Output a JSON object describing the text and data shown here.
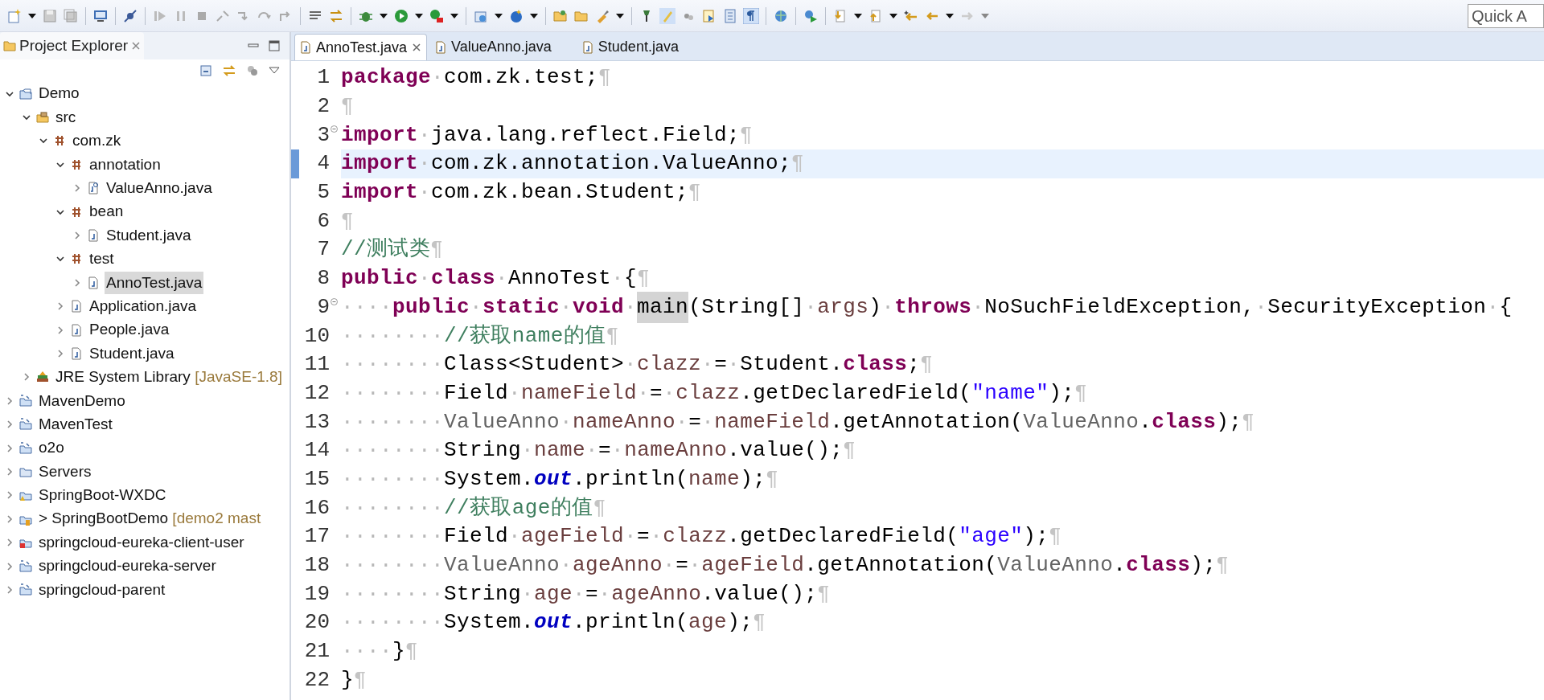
{
  "toolbar": {
    "quick_access": {
      "placeholder": "Quick A"
    }
  },
  "explorer": {
    "title": "Project Explorer",
    "tree": [
      {
        "label": "Demo",
        "kind": "project",
        "expanded": true,
        "selected": false,
        "children": [
          {
            "label": "src",
            "kind": "source-folder",
            "expanded": true,
            "selected": false,
            "children": [
              {
                "label": "com.zk",
                "kind": "package",
                "expanded": true,
                "selected": false,
                "children": [
                  {
                    "label": "annotation",
                    "kind": "package",
                    "expanded": true,
                    "selected": false,
                    "children": [
                      {
                        "label": "ValueAnno.java",
                        "kind": "annotation-file",
                        "expanded": false,
                        "selected": false
                      }
                    ]
                  },
                  {
                    "label": "bean",
                    "kind": "package",
                    "expanded": true,
                    "selected": false,
                    "children": [
                      {
                        "label": "Student.java",
                        "kind": "java-file",
                        "expanded": false,
                        "selected": false
                      }
                    ]
                  },
                  {
                    "label": "test",
                    "kind": "package",
                    "expanded": true,
                    "selected": false,
                    "children": [
                      {
                        "label": "AnnoTest.java",
                        "kind": "java-file",
                        "expanded": false,
                        "selected": true
                      }
                    ]
                  },
                  {
                    "label": "Application.java",
                    "kind": "java-file",
                    "expanded": false,
                    "selected": false
                  },
                  {
                    "label": "People.java",
                    "kind": "java-file",
                    "expanded": false,
                    "selected": false
                  },
                  {
                    "label": "Student.java",
                    "kind": "java-file",
                    "expanded": false,
                    "selected": false
                  }
                ]
              }
            ]
          },
          {
            "label": "JRE System Library",
            "decoration": "[JavaSE-1.8]",
            "kind": "library",
            "expanded": false,
            "selected": false
          }
        ]
      },
      {
        "label": "MavenDemo",
        "kind": "maven-project",
        "expanded": false,
        "selected": false
      },
      {
        "label": "MavenTest",
        "kind": "maven-project",
        "expanded": false,
        "selected": false
      },
      {
        "label": "o2o",
        "kind": "maven-project",
        "expanded": false,
        "selected": false
      },
      {
        "label": "Servers",
        "kind": "folder",
        "expanded": false,
        "selected": false
      },
      {
        "label": "SpringBoot-WXDC",
        "kind": "warning-project",
        "expanded": false,
        "selected": false
      },
      {
        "label": "> SpringBootDemo",
        "decoration": "[demo2 mast",
        "kind": "git-project",
        "expanded": false,
        "selected": false
      },
      {
        "label": "springcloud-eureka-client-user",
        "kind": "error-project",
        "expanded": false,
        "selected": false
      },
      {
        "label": "springcloud-eureka-server",
        "kind": "maven-project",
        "expanded": false,
        "selected": false
      },
      {
        "label": "springcloud-parent",
        "kind": "maven-project",
        "expanded": false,
        "selected": false
      }
    ]
  },
  "editor": {
    "tabs": [
      {
        "label": "AnnoTest.java",
        "selected": true
      },
      {
        "label": "ValueAnno.java",
        "selected": false
      },
      {
        "label": "Student.java",
        "selected": false
      }
    ],
    "lines": [
      {
        "no": "1",
        "fold": false,
        "current": false,
        "tokens": [
          {
            "kind": "kw",
            "text": "package"
          },
          {
            "kind": "ws",
            "text": "·"
          },
          {
            "kind": "p",
            "text": "com.zk.test;"
          },
          {
            "kind": "eol",
            "text": "¶"
          }
        ]
      },
      {
        "no": "2",
        "fold": false,
        "current": false,
        "tokens": [
          {
            "kind": "eol",
            "text": "¶"
          }
        ]
      },
      {
        "no": "3",
        "fold": true,
        "current": false,
        "tokens": [
          {
            "kind": "kw",
            "text": "import"
          },
          {
            "kind": "ws",
            "text": "·"
          },
          {
            "kind": "p",
            "text": "java.lang.reflect.Field;"
          },
          {
            "kind": "eol",
            "text": "¶"
          }
        ]
      },
      {
        "no": "4",
        "fold": false,
        "current": true,
        "tokens": [
          {
            "kind": "kw",
            "text": "import"
          },
          {
            "kind": "ws",
            "text": "·"
          },
          {
            "kind": "p",
            "text": "com.zk.annotation.ValueAnno;"
          },
          {
            "kind": "eol",
            "text": "¶"
          }
        ]
      },
      {
        "no": "5",
        "fold": false,
        "current": false,
        "tokens": [
          {
            "kind": "kw",
            "text": "import"
          },
          {
            "kind": "ws",
            "text": "·"
          },
          {
            "kind": "p",
            "text": "com.zk.bean.Student;"
          },
          {
            "kind": "eol",
            "text": "¶"
          }
        ]
      },
      {
        "no": "6",
        "fold": false,
        "current": false,
        "tokens": [
          {
            "kind": "eol",
            "text": "¶"
          }
        ]
      },
      {
        "no": "7",
        "fold": false,
        "current": false,
        "tokens": [
          {
            "kind": "cm",
            "text": "//测试类"
          },
          {
            "kind": "eol",
            "text": "¶"
          }
        ]
      },
      {
        "no": "8",
        "fold": false,
        "current": false,
        "tokens": [
          {
            "kind": "kw",
            "text": "public"
          },
          {
            "kind": "ws",
            "text": "·"
          },
          {
            "kind": "kw",
            "text": "class"
          },
          {
            "kind": "ws",
            "text": "·"
          },
          {
            "kind": "p",
            "text": "AnnoTest"
          },
          {
            "kind": "ws",
            "text": "·"
          },
          {
            "kind": "p",
            "text": "{"
          },
          {
            "kind": "eol",
            "text": "¶"
          }
        ]
      },
      {
        "no": "9",
        "fold": true,
        "current": false,
        "tokens": [
          {
            "kind": "ws",
            "text": "····"
          },
          {
            "kind": "kw",
            "text": "public"
          },
          {
            "kind": "ws",
            "text": "·"
          },
          {
            "kind": "kw",
            "text": "static"
          },
          {
            "kind": "ws",
            "text": "·"
          },
          {
            "kind": "kw",
            "text": "void"
          },
          {
            "kind": "ws",
            "text": "·"
          },
          {
            "kind": "hl",
            "text": "main"
          },
          {
            "kind": "p",
            "text": "(String[]"
          },
          {
            "kind": "ws",
            "text": "·"
          },
          {
            "kind": "var",
            "text": "args"
          },
          {
            "kind": "p",
            "text": ")"
          },
          {
            "kind": "ws",
            "text": "·"
          },
          {
            "kind": "kw",
            "text": "throws"
          },
          {
            "kind": "ws",
            "text": "·"
          },
          {
            "kind": "p",
            "text": "NoSuchFieldException,"
          },
          {
            "kind": "ws",
            "text": "·"
          },
          {
            "kind": "p",
            "text": "SecurityException"
          },
          {
            "kind": "ws",
            "text": "·"
          },
          {
            "kind": "p",
            "text": "{"
          }
        ]
      },
      {
        "no": "10",
        "fold": false,
        "current": false,
        "tokens": [
          {
            "kind": "ws",
            "text": "········"
          },
          {
            "kind": "cm",
            "text": "//获取name的值"
          },
          {
            "kind": "eol",
            "text": "¶"
          }
        ]
      },
      {
        "no": "11",
        "fold": false,
        "current": false,
        "tokens": [
          {
            "kind": "ws",
            "text": "········"
          },
          {
            "kind": "p",
            "text": "Class<Student>"
          },
          {
            "kind": "ws",
            "text": "·"
          },
          {
            "kind": "var",
            "text": "clazz"
          },
          {
            "kind": "ws",
            "text": "·"
          },
          {
            "kind": "p",
            "text": "="
          },
          {
            "kind": "ws",
            "text": "·"
          },
          {
            "kind": "p",
            "text": "Student."
          },
          {
            "kind": "kw",
            "text": "class"
          },
          {
            "kind": "p",
            "text": ";"
          },
          {
            "kind": "eol",
            "text": "¶"
          }
        ]
      },
      {
        "no": "12",
        "fold": false,
        "current": false,
        "tokens": [
          {
            "kind": "ws",
            "text": "········"
          },
          {
            "kind": "p",
            "text": "Field"
          },
          {
            "kind": "ws",
            "text": "·"
          },
          {
            "kind": "var",
            "text": "nameField"
          },
          {
            "kind": "ws",
            "text": "·"
          },
          {
            "kind": "p",
            "text": "="
          },
          {
            "kind": "ws",
            "text": "·"
          },
          {
            "kind": "var",
            "text": "clazz"
          },
          {
            "kind": "p",
            "text": ".getDeclaredField("
          },
          {
            "kind": "str",
            "text": "\"name\""
          },
          {
            "kind": "p",
            "text": ");"
          },
          {
            "kind": "eol",
            "text": "¶"
          }
        ]
      },
      {
        "no": "13",
        "fold": false,
        "current": false,
        "tokens": [
          {
            "kind": "ws",
            "text": "········"
          },
          {
            "kind": "ty",
            "text": "ValueAnno"
          },
          {
            "kind": "ws",
            "text": "·"
          },
          {
            "kind": "var",
            "text": "nameAnno"
          },
          {
            "kind": "ws",
            "text": "·"
          },
          {
            "kind": "p",
            "text": "="
          },
          {
            "kind": "ws",
            "text": "·"
          },
          {
            "kind": "var",
            "text": "nameField"
          },
          {
            "kind": "p",
            "text": ".getAnnotation("
          },
          {
            "kind": "ty",
            "text": "ValueAnno"
          },
          {
            "kind": "p",
            "text": "."
          },
          {
            "kind": "kw",
            "text": "class"
          },
          {
            "kind": "p",
            "text": ");"
          },
          {
            "kind": "eol",
            "text": "¶"
          }
        ]
      },
      {
        "no": "14",
        "fold": false,
        "current": false,
        "tokens": [
          {
            "kind": "ws",
            "text": "········"
          },
          {
            "kind": "p",
            "text": "String"
          },
          {
            "kind": "ws",
            "text": "·"
          },
          {
            "kind": "var",
            "text": "name"
          },
          {
            "kind": "ws",
            "text": "·"
          },
          {
            "kind": "p",
            "text": "="
          },
          {
            "kind": "ws",
            "text": "·"
          },
          {
            "kind": "var",
            "text": "nameAnno"
          },
          {
            "kind": "p",
            "text": ".value();"
          },
          {
            "kind": "eol",
            "text": "¶"
          }
        ]
      },
      {
        "no": "15",
        "fold": false,
        "current": false,
        "tokens": [
          {
            "kind": "ws",
            "text": "········"
          },
          {
            "kind": "p",
            "text": "System."
          },
          {
            "kind": "fld",
            "text": "out"
          },
          {
            "kind": "p",
            "text": ".println("
          },
          {
            "kind": "var",
            "text": "name"
          },
          {
            "kind": "p",
            "text": ");"
          },
          {
            "kind": "eol",
            "text": "¶"
          }
        ]
      },
      {
        "no": "16",
        "fold": false,
        "current": false,
        "tokens": [
          {
            "kind": "ws",
            "text": "········"
          },
          {
            "kind": "cm",
            "text": "//获取age的值"
          },
          {
            "kind": "eol",
            "text": "¶"
          }
        ]
      },
      {
        "no": "17",
        "fold": false,
        "current": false,
        "tokens": [
          {
            "kind": "ws",
            "text": "········"
          },
          {
            "kind": "p",
            "text": "Field"
          },
          {
            "kind": "ws",
            "text": "·"
          },
          {
            "kind": "var",
            "text": "ageField"
          },
          {
            "kind": "ws",
            "text": "·"
          },
          {
            "kind": "p",
            "text": "="
          },
          {
            "kind": "ws",
            "text": "·"
          },
          {
            "kind": "var",
            "text": "clazz"
          },
          {
            "kind": "p",
            "text": ".getDeclaredField("
          },
          {
            "kind": "str",
            "text": "\"age\""
          },
          {
            "kind": "p",
            "text": ");"
          },
          {
            "kind": "eol",
            "text": "¶"
          }
        ]
      },
      {
        "no": "18",
        "fold": false,
        "current": false,
        "tokens": [
          {
            "kind": "ws",
            "text": "········"
          },
          {
            "kind": "ty",
            "text": "ValueAnno"
          },
          {
            "kind": "ws",
            "text": "·"
          },
          {
            "kind": "var",
            "text": "ageAnno"
          },
          {
            "kind": "ws",
            "text": "·"
          },
          {
            "kind": "p",
            "text": "="
          },
          {
            "kind": "ws",
            "text": "·"
          },
          {
            "kind": "var",
            "text": "ageField"
          },
          {
            "kind": "p",
            "text": ".getAnnotation("
          },
          {
            "kind": "ty",
            "text": "ValueAnno"
          },
          {
            "kind": "p",
            "text": "."
          },
          {
            "kind": "kw",
            "text": "class"
          },
          {
            "kind": "p",
            "text": ");"
          },
          {
            "kind": "eol",
            "text": "¶"
          }
        ]
      },
      {
        "no": "19",
        "fold": false,
        "current": false,
        "tokens": [
          {
            "kind": "ws",
            "text": "········"
          },
          {
            "kind": "p",
            "text": "String"
          },
          {
            "kind": "ws",
            "text": "·"
          },
          {
            "kind": "var",
            "text": "age"
          },
          {
            "kind": "ws",
            "text": "·"
          },
          {
            "kind": "p",
            "text": "="
          },
          {
            "kind": "ws",
            "text": "·"
          },
          {
            "kind": "var",
            "text": "ageAnno"
          },
          {
            "kind": "p",
            "text": ".value();"
          },
          {
            "kind": "eol",
            "text": "¶"
          }
        ]
      },
      {
        "no": "20",
        "fold": false,
        "current": false,
        "tokens": [
          {
            "kind": "ws",
            "text": "········"
          },
          {
            "kind": "p",
            "text": "System."
          },
          {
            "kind": "fld",
            "text": "out"
          },
          {
            "kind": "p",
            "text": ".println("
          },
          {
            "kind": "var",
            "text": "age"
          },
          {
            "kind": "p",
            "text": ");"
          },
          {
            "kind": "eol",
            "text": "¶"
          }
        ]
      },
      {
        "no": "21",
        "fold": false,
        "current": false,
        "tokens": [
          {
            "kind": "ws",
            "text": "····"
          },
          {
            "kind": "p",
            "text": "}"
          },
          {
            "kind": "eol",
            "text": "¶"
          }
        ]
      },
      {
        "no": "22",
        "fold": false,
        "current": false,
        "tokens": [
          {
            "kind": "p",
            "text": "}"
          },
          {
            "kind": "eol",
            "text": "¶"
          }
        ]
      }
    ]
  }
}
